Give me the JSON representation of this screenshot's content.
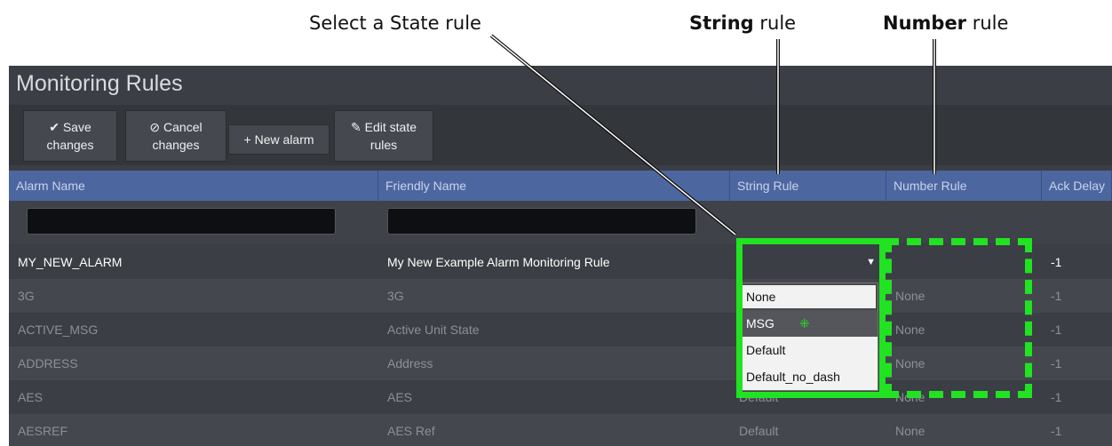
{
  "callouts": {
    "select_state": "Select a State rule",
    "string_rule_bold": "String",
    "string_rule_rest": " rule",
    "number_rule_bold": "Number",
    "number_rule_rest": " rule"
  },
  "window": {
    "title": "Monitoring Rules"
  },
  "toolbar": {
    "save": {
      "line1": "Save",
      "line2": "changes",
      "icon": "check-icon"
    },
    "cancel": {
      "line1": "Cancel",
      "line2": "changes",
      "icon": "cancel-circle-icon"
    },
    "new_alarm": {
      "label": "New alarm",
      "icon": "plus-icon"
    },
    "edit_state": {
      "line1": "Edit state",
      "line2": "rules",
      "icon": "pencil-icon"
    }
  },
  "columns": [
    "Alarm Name",
    "Friendly Name",
    "String Rule",
    "Number Rule",
    "Ack Delay"
  ],
  "rows": [
    {
      "name": "MY_NEW_ALARM",
      "friendly": "My New Example Alarm Monitoring Rule",
      "string": "",
      "number": "",
      "ack": "-1"
    },
    {
      "name": "3G",
      "friendly": "3G",
      "string": "",
      "number": "None",
      "ack": "-1"
    },
    {
      "name": "ACTIVE_MSG",
      "friendly": "Active Unit State",
      "string": "",
      "number": "None",
      "ack": "-1"
    },
    {
      "name": "ADDRESS",
      "friendly": "Address",
      "string": "",
      "number": "None",
      "ack": "-1"
    },
    {
      "name": "AES",
      "friendly": "AES",
      "string": "Default",
      "number": "None",
      "ack": "-1"
    },
    {
      "name": "AESREF",
      "friendly": "AES Ref",
      "string": "Default",
      "number": "None",
      "ack": "-1"
    }
  ],
  "dropdown": {
    "options": [
      "None",
      "MSG",
      "Default",
      "Default_no_dash"
    ],
    "selected": "MSG"
  },
  "colors": {
    "highlight": "#22e322",
    "header": "#4c67a0"
  }
}
